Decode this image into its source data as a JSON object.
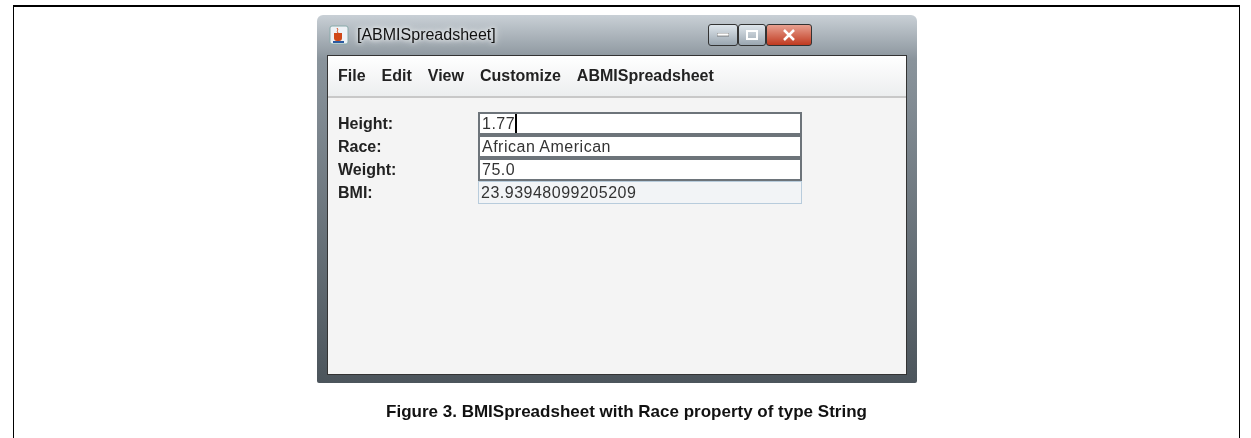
{
  "window": {
    "title": "[ABMISpreadsheet]"
  },
  "menu": [
    {
      "label": "File"
    },
    {
      "label": "Edit"
    },
    {
      "label": "View"
    },
    {
      "label": "Customize"
    },
    {
      "label": "ABMISpreadsheet"
    }
  ],
  "properties": [
    {
      "label": "Height:",
      "value": "1.77",
      "editable": true,
      "focused": true
    },
    {
      "label": "Race:",
      "value": "African American",
      "editable": true,
      "focused": false
    },
    {
      "label": "Weight:",
      "value": "75.0",
      "editable": true,
      "focused": false
    },
    {
      "label": "BMI:",
      "value": "23.93948099205209",
      "editable": false,
      "focused": false
    }
  ],
  "caption": "Figure 3. BMISpreadsheet with Race property of type String"
}
